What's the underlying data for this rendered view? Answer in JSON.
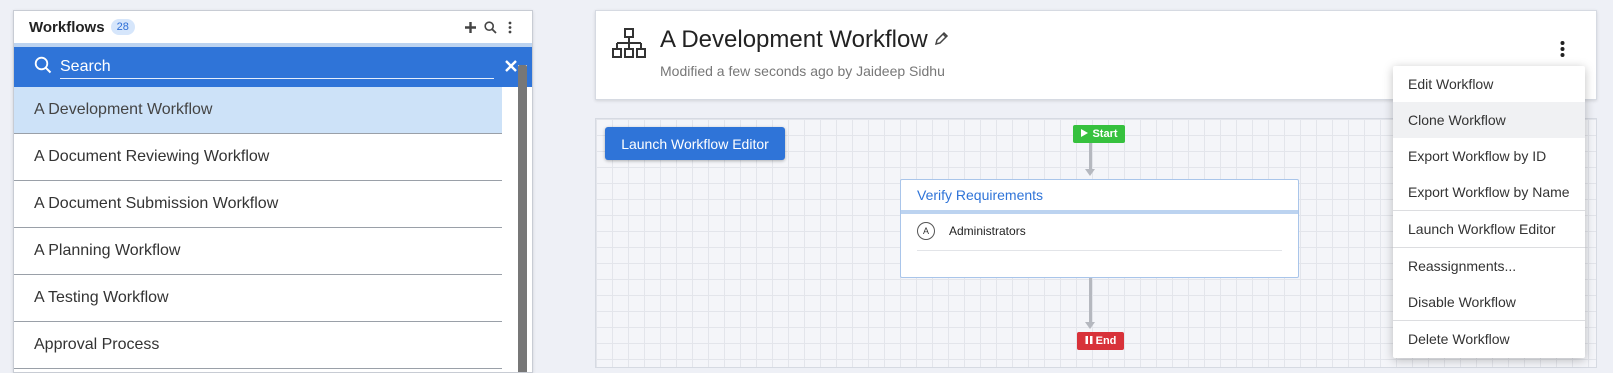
{
  "sidebar": {
    "title": "Workflows",
    "count": "28",
    "search_placeholder": "Search",
    "items": [
      {
        "label": "A Development Workflow",
        "selected": true
      },
      {
        "label": "A Document Reviewing Workflow"
      },
      {
        "label": "A Document Submission Workflow"
      },
      {
        "label": "A Planning Workflow"
      },
      {
        "label": "A Testing Workflow"
      },
      {
        "label": "Approval Process"
      }
    ],
    "icons": [
      "plus-icon",
      "search-icon",
      "more-vertical-icon",
      "close-icon"
    ]
  },
  "header": {
    "title": "A Development Workflow",
    "subtitle": "Modified a few seconds ago by Jaideep Sidhu",
    "icons": [
      "hierarchy-icon",
      "pencil-icon",
      "more-vertical-icon"
    ]
  },
  "canvas": {
    "launch_button": "Launch Workflow Editor",
    "start_label": "Start",
    "end_label": "End",
    "task": {
      "title": "Verify Requirements",
      "assignee_initial": "A",
      "assignee": "Administrators"
    }
  },
  "menu": {
    "items": [
      {
        "label": "Edit Workflow"
      },
      {
        "label": "Clone Workflow",
        "hover": true
      },
      {
        "label": "Export Workflow by ID"
      },
      {
        "label": "Export Workflow by Name"
      },
      {
        "label": "Launch Workflow Editor"
      },
      {
        "label": "Reassignments..."
      },
      {
        "label": "Disable Workflow"
      },
      {
        "label": "Delete Workflow"
      }
    ]
  },
  "colors": {
    "accent": "#2f74d8",
    "selected_row": "#cde2f8",
    "start": "#36c13e",
    "end": "#d8323a"
  }
}
